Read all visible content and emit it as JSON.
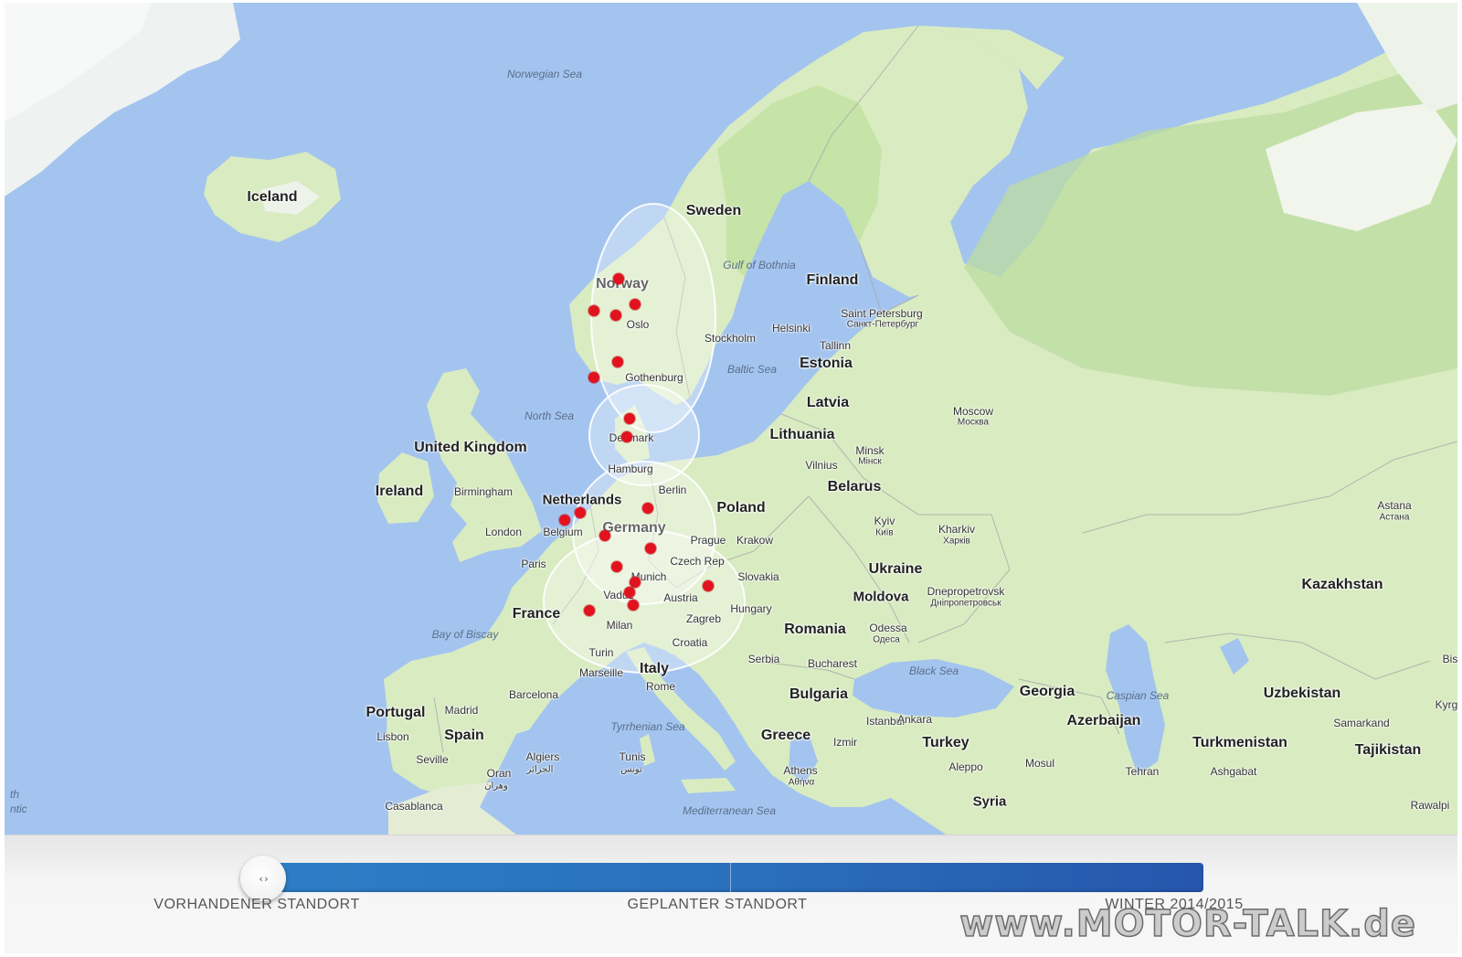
{
  "map": {
    "countries": [
      "Iceland",
      "Norway",
      "Sweden",
      "Finland",
      "Estonia",
      "Latvia",
      "Lithuania",
      "Belarus",
      "Poland",
      "Germany",
      "Denmark",
      "Netherlands",
      "Belgium",
      "Czech Rep",
      "Slovakia",
      "Austria",
      "Hungary",
      "France",
      "Italy",
      "Croatia",
      "Serbia",
      "Romania",
      "Moldova",
      "Ukraine",
      "Bulgaria",
      "Greece",
      "Turkey",
      "Georgia",
      "Azerbaijan",
      "Uzbekistan",
      "Turkmenistan",
      "Tajikistan",
      "Kazakhstan",
      "Portugal",
      "Spain",
      "Ireland",
      "United Kingdom",
      "Syria",
      "Kyrg",
      "Bis"
    ],
    "cities": [
      "Oslo",
      "Stockholm",
      "Helsinki",
      "Saint Petersburg",
      "Санкт-Петербург",
      "Tallinn",
      "Gothenburg",
      "Moscow",
      "Москва",
      "Minsk",
      "Мінск",
      "Vilnius",
      "Hamburg",
      "Berlin",
      "Prague",
      "Krakow",
      "Munich",
      "Vaduz",
      "Milan",
      "Turin",
      "Zagreb",
      "Paris",
      "London",
      "Birmingham",
      "Marseille",
      "Barcelona",
      "Madrid",
      "Lisbon",
      "Seville",
      "Rome",
      "Algiers",
      "الجزائر",
      "Tunis",
      "تونس",
      "Oran",
      "وهران",
      "Casablanca",
      "Bucharest",
      "Odessa",
      "Одеса",
      "Kyiv",
      "Київ",
      "Kharkiv",
      "Харків",
      "Dnepropetrovsk",
      "Дніпропетровськ",
      "Istanbul",
      "Ankara",
      "Izmir",
      "Athens",
      "Αθήνα",
      "Aleppo",
      "Mosul",
      "Tehran",
      "Ashgabat",
      "Samarkand",
      "Astana",
      "Астана",
      "Rawalpi"
    ],
    "seas": [
      "Norwegian Sea",
      "North Sea",
      "Baltic Sea",
      "Gulf of Bothnia",
      "Bay of Biscay",
      "Tyrrhenian Sea",
      "Mediterranean Sea",
      "Black Sea",
      "Caspian Sea",
      "th",
      "ntic"
    ],
    "colors": {
      "water": "#a3c4ef",
      "land": "#d9ebc1",
      "forest": "#b8dd9a",
      "marker": "#e2121f",
      "coverage": "rgba(255,255,255,0.3)"
    }
  },
  "timeline": {
    "label_existing": "VORHANDENER STANDORT",
    "label_planned": "GEPLANTER STANDORT",
    "label_winter": "WINTER 2014/2015",
    "handle_icon": "‹ ›",
    "position": 0,
    "bar_colors": [
      "#2c7ec6",
      "#2656ad"
    ]
  },
  "watermark": "www.MOTOR-TALK.de"
}
